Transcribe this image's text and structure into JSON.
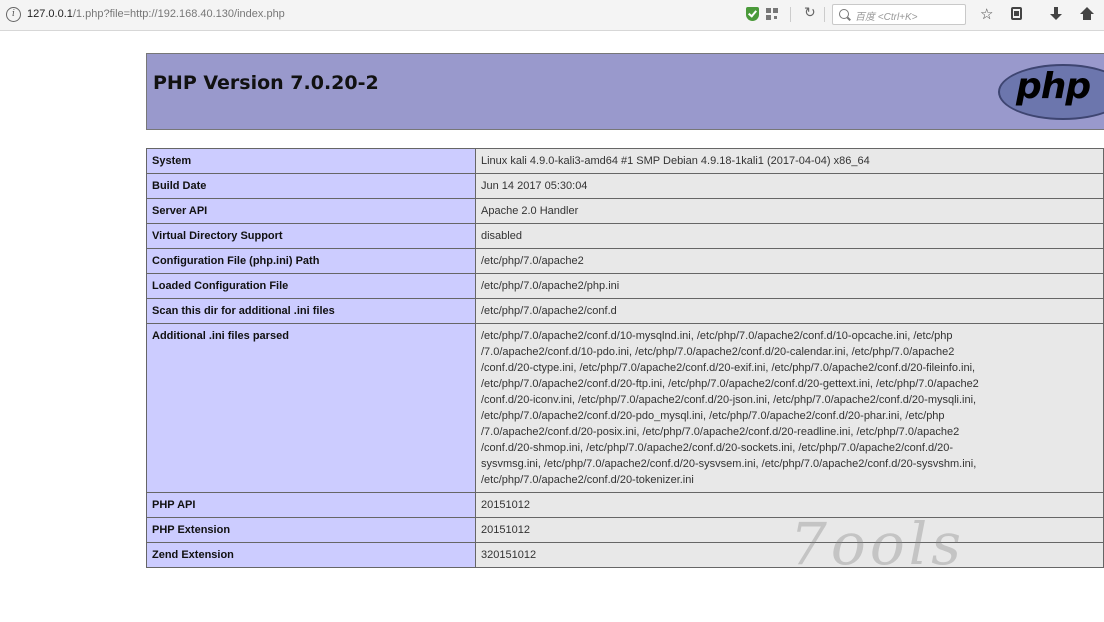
{
  "browser": {
    "url_host": "127.0.0.1",
    "url_rest": "/1.php?file=http://192.168.40.130/index.php",
    "search_placeholder": "百度 <Ctrl+K>"
  },
  "php": {
    "version_title": "PHP Version 7.0.20-2",
    "logo_text": "php"
  },
  "rows": [
    {
      "key": "System",
      "value": "Linux kali 4.9.0-kali3-amd64 #1 SMP Debian 4.9.18-1kali1 (2017-04-04) x86_64"
    },
    {
      "key": "Build Date",
      "value": "Jun 14 2017 05:30:04"
    },
    {
      "key": "Server API",
      "value": "Apache 2.0 Handler"
    },
    {
      "key": "Virtual Directory Support",
      "value": "disabled"
    },
    {
      "key": "Configuration File (php.ini) Path",
      "value": "/etc/php/7.0/apache2"
    },
    {
      "key": "Loaded Configuration File",
      "value": "/etc/php/7.0/apache2/php.ini"
    },
    {
      "key": "Scan this dir for additional .ini files",
      "value": "/etc/php/7.0/apache2/conf.d"
    },
    {
      "key": "Additional .ini files parsed",
      "value": "/etc/php/7.0/apache2/conf.d/10-mysqlnd.ini, /etc/php/7.0/apache2/conf.d/10-opcache.ini, /etc/php\n/7.0/apache2/conf.d/10-pdo.ini, /etc/php/7.0/apache2/conf.d/20-calendar.ini, /etc/php/7.0/apache2\n/conf.d/20-ctype.ini, /etc/php/7.0/apache2/conf.d/20-exif.ini, /etc/php/7.0/apache2/conf.d/20-fileinfo.ini,\n/etc/php/7.0/apache2/conf.d/20-ftp.ini, /etc/php/7.0/apache2/conf.d/20-gettext.ini, /etc/php/7.0/apache2\n/conf.d/20-iconv.ini, /etc/php/7.0/apache2/conf.d/20-json.ini, /etc/php/7.0/apache2/conf.d/20-mysqli.ini,\n/etc/php/7.0/apache2/conf.d/20-pdo_mysql.ini, /etc/php/7.0/apache2/conf.d/20-phar.ini, /etc/php\n/7.0/apache2/conf.d/20-posix.ini, /etc/php/7.0/apache2/conf.d/20-readline.ini, /etc/php/7.0/apache2\n/conf.d/20-shmop.ini, /etc/php/7.0/apache2/conf.d/20-sockets.ini, /etc/php/7.0/apache2/conf.d/20-\nsysvmsg.ini, /etc/php/7.0/apache2/conf.d/20-sysvsem.ini, /etc/php/7.0/apache2/conf.d/20-sysvshm.ini,\n/etc/php/7.0/apache2/conf.d/20-tokenizer.ini"
    },
    {
      "key": "PHP API",
      "value": "20151012"
    },
    {
      "key": "PHP Extension",
      "value": "20151012"
    },
    {
      "key": "Zend Extension",
      "value": "320151012"
    }
  ],
  "watermark": "7ools"
}
